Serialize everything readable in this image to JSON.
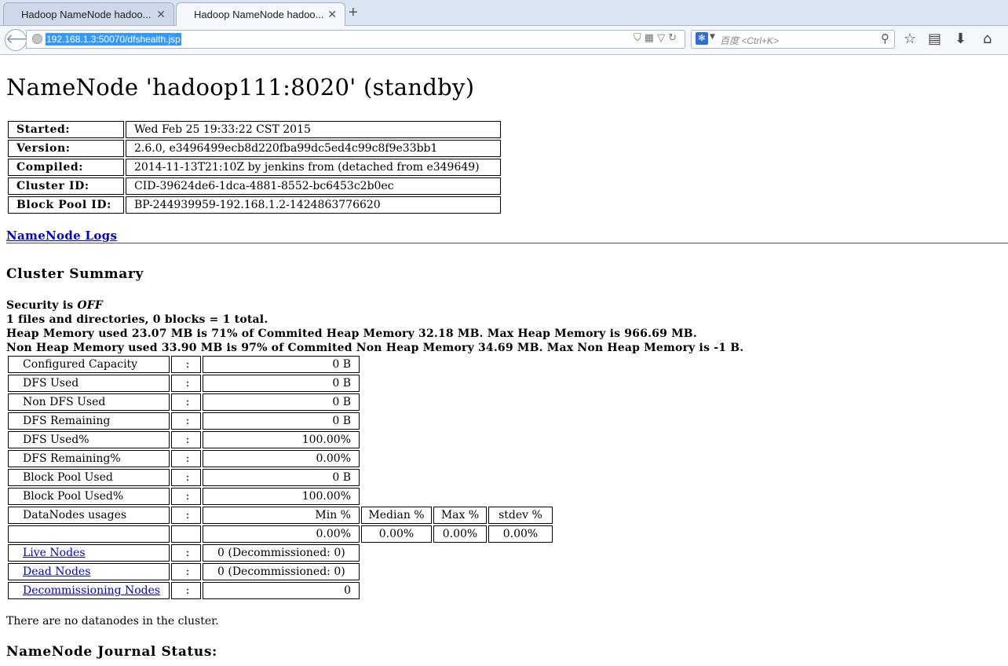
{
  "browser": {
    "tabs": [
      {
        "title": "Hadoop NameNode hadoo..."
      },
      {
        "title": "Hadoop NameNode hadoo..."
      }
    ],
    "url": "192.168.1.3:50070/dfshealth.jsp",
    "search_placeholder": "百度 <Ctrl+K>"
  },
  "page": {
    "title": "NameNode 'hadoop111:8020' (standby)",
    "info": [
      {
        "label": "Started:",
        "value": "Wed Feb 25 19:33:22 CST 2015"
      },
      {
        "label": "Version:",
        "value": "2.6.0, e3496499ecb8d220fba99dc5ed4c99c8f9e33bb1"
      },
      {
        "label": "Compiled:",
        "value": "2014-11-13T21:10Z by jenkins from (detached from e349649)"
      },
      {
        "label": "Cluster ID:",
        "value": "CID-39624de6-1dca-4881-8552-bc6453c2b0ec"
      },
      {
        "label": "Block Pool ID:",
        "value": "BP-244939959-192.168.1.2-1424863776620"
      }
    ],
    "logs_link": "NameNode Logs",
    "cluster_summary_heading": "Cluster Summary",
    "security_prefix": "Security is ",
    "security_value": "OFF",
    "summary_lines": [
      "1 files and directories, 0 blocks = 1 total.",
      "Heap Memory used 23.07 MB is 71% of Commited Heap Memory 32.18 MB. Max Heap Memory is 966.69 MB.",
      "Non Heap Memory used 33.90 MB is 97% of Commited Non Heap Memory 34.69 MB. Max Non Heap Memory is -1 B."
    ],
    "colon": ":",
    "stats": [
      {
        "label": "Configured Capacity",
        "value": "0 B"
      },
      {
        "label": "DFS Used",
        "value": "0 B"
      },
      {
        "label": "Non DFS Used",
        "value": "0 B"
      },
      {
        "label": "DFS Remaining",
        "value": "0 B"
      },
      {
        "label": "DFS Used%",
        "value": "100.00%"
      },
      {
        "label": "DFS Remaining%",
        "value": "0.00%"
      },
      {
        "label": "Block Pool Used",
        "value": "0 B"
      },
      {
        "label": "Block Pool Used%",
        "value": "100.00%"
      }
    ],
    "datanodes_usages": {
      "label": "DataNodes usages",
      "headers": [
        "Min %",
        "Median %",
        "Max %",
        "stdev %"
      ],
      "values": [
        "0.00%",
        "0.00%",
        "0.00%",
        "0.00%"
      ]
    },
    "nodes": [
      {
        "label": "Live Nodes",
        "value": "0 (Decommissioned: 0)"
      },
      {
        "label": "Dead Nodes",
        "value": "0 (Decommissioned: 0)"
      },
      {
        "label": "Decommissioning Nodes",
        "value": "0"
      }
    ],
    "no_datanodes_text": "There are no datanodes in the cluster.",
    "journal_heading": "NameNode Journal Status:"
  }
}
